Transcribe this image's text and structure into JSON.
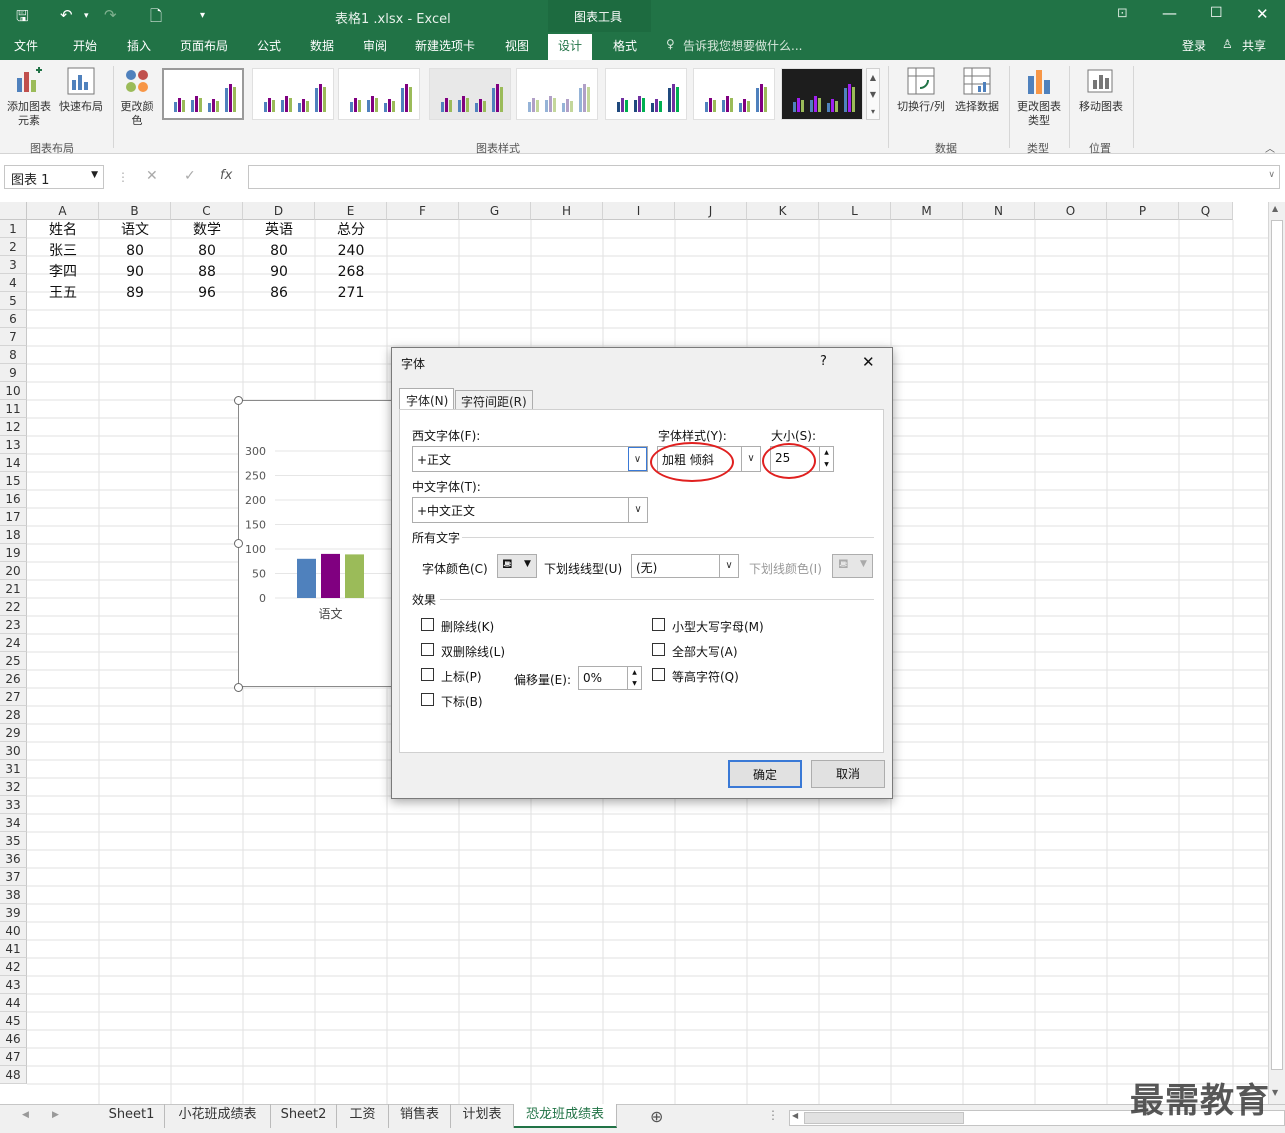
{
  "titlebar": {
    "filename": "表格1 .xlsx - Excel",
    "tool_title": "图表工具",
    "login": "登录",
    "share": "共享"
  },
  "tabs": [
    "文件",
    "开始",
    "插入",
    "页面布局",
    "公式",
    "数据",
    "审阅",
    "新建选项卡",
    "视图",
    "设计",
    "格式"
  ],
  "tell_me": "告诉我您想要做什么...",
  "ribbon": {
    "add_element": "添加图表元素",
    "quick_layout": "快速布局",
    "change_color": "更改颜色",
    "switch_rowcol": "切换行/列",
    "select_data": "选择数据",
    "change_type": "更改图表类型",
    "move_chart": "移动图表",
    "groups": {
      "layout": "图表布局",
      "styles": "图表样式",
      "data": "数据",
      "type": "类型",
      "location": "位置"
    }
  },
  "namebox": "图表 1",
  "fx": "fx",
  "columns": [
    "A",
    "B",
    "C",
    "D",
    "E",
    "F",
    "G",
    "H",
    "I",
    "J",
    "K",
    "L",
    "M",
    "N",
    "O",
    "P",
    "Q"
  ],
  "rows": [
    "1",
    "2",
    "3",
    "4",
    "5",
    "6",
    "7",
    "8",
    "9",
    "10",
    "11",
    "12",
    "13",
    "14",
    "15",
    "16",
    "17",
    "18",
    "19",
    "20",
    "21",
    "22",
    "23",
    "24",
    "25",
    "26",
    "27",
    "28",
    "29",
    "30",
    "31",
    "32",
    "33",
    "34",
    "35",
    "36",
    "37",
    "38",
    "39",
    "40",
    "41",
    "42",
    "43",
    "44",
    "45",
    "46",
    "47",
    "48"
  ],
  "table": {
    "header": [
      "姓名",
      "语文",
      "数学",
      "英语",
      "总分"
    ],
    "r1": [
      "张三",
      "80",
      "80",
      "80",
      "240"
    ],
    "r2": [
      "李四",
      "90",
      "88",
      "90",
      "268"
    ],
    "r3": [
      "王五",
      "89",
      "96",
      "86",
      "271"
    ]
  },
  "chart_data": {
    "type": "bar",
    "categories": [
      "语文"
    ],
    "series": [
      {
        "values": [
          80
        ],
        "color": "#4f81bd"
      },
      {
        "values": [
          90
        ],
        "color": "#800080"
      },
      {
        "values": [
          89
        ],
        "color": "#9bbb59"
      }
    ],
    "yticks": [
      "300",
      "250",
      "200",
      "150",
      "100",
      "50",
      "0"
    ],
    "ylim": [
      0,
      300
    ]
  },
  "dialog": {
    "title": "字体",
    "help": "?",
    "close": "✕",
    "tab_font": "字体(N)",
    "tab_spacing": "字符间距(R)",
    "western_font_label": "西文字体(F):",
    "western_font_value": "+正文",
    "style_label": "字体样式(Y):",
    "style_value": "加粗 倾斜",
    "size_label": "大小(S):",
    "size_value": "25",
    "chinese_font_label": "中文字体(T):",
    "chinese_font_value": "+中文正文",
    "all_text": "所有文字",
    "font_color_label": "字体颜色(C)",
    "underline_label": "下划线线型(U)",
    "underline_value": "(无)",
    "underline_color_label": "下划线颜色(I)",
    "effects": "效果",
    "strike": "删除线(K)",
    "double_strike": "双删除线(L)",
    "superscript": "上标(P)",
    "subscript": "下标(B)",
    "offset_label": "偏移量(E):",
    "offset_value": "0%",
    "small_caps": "小型大写字母(M)",
    "all_caps": "全部大写(A)",
    "equal_height": "等高字符(Q)",
    "ok": "确定",
    "cancel": "取消"
  },
  "sheets": [
    "Sheet1",
    "小花班成绩表",
    "Sheet2",
    "工资",
    "销售表",
    "计划表",
    "恐龙班成绩表"
  ],
  "watermark": "最需教育"
}
